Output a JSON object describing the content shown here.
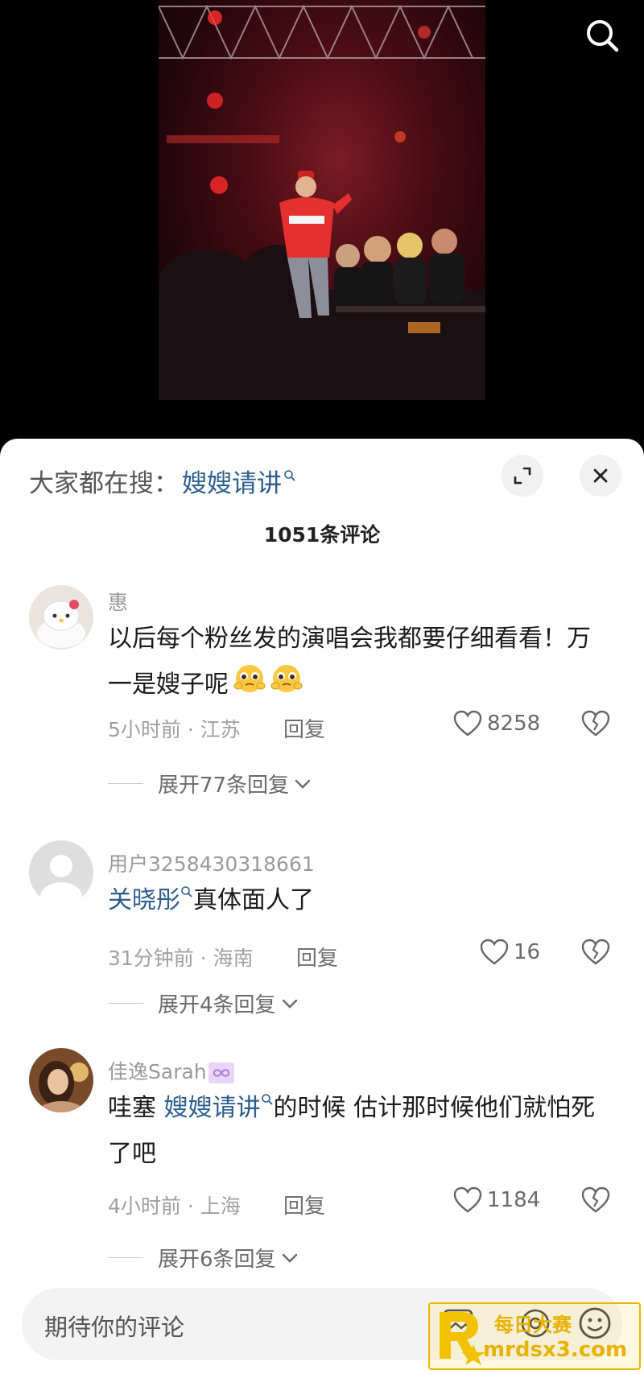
{
  "hot_search": {
    "prefix": "大家都在搜：",
    "keyword": "嫂嫂请讲"
  },
  "comment_count": "1051条评论",
  "comments": [
    {
      "username": "惠",
      "text": "以后每个粉丝发的演唱会我都要仔细看看！万一是嫂子呢",
      "emoji": [
        "pleading-face-emoji",
        "pleading-face-emoji"
      ],
      "time_location": "5小时前 · 江苏",
      "reply_label": "回复",
      "likes": "8258",
      "expand_label": "展开77条回复"
    },
    {
      "username": "用户3258430318661",
      "mention": "关晓彤",
      "text": "真体面人了",
      "time_location": "31分钟前 · 海南",
      "reply_label": "回复",
      "likes": "16",
      "expand_label": "展开4条回复"
    },
    {
      "username": "佳逸Sarah",
      "username_badge": "infinity-badge",
      "prefix": "哇塞 ",
      "mention": "嫂嫂请讲",
      "text": "的时候 估计那时候他们就怕死了吧",
      "time_location": "4小时前 · 上海",
      "reply_label": "回复",
      "likes": "1184",
      "expand_label": "展开6条回复"
    }
  ],
  "input": {
    "placeholder": "期待你的评论"
  },
  "watermark": {
    "title": "每日大赛",
    "url": "mrdsx3.com"
  },
  "colors": {
    "link": "#2c5d8f",
    "watermark": "#e9b200"
  }
}
